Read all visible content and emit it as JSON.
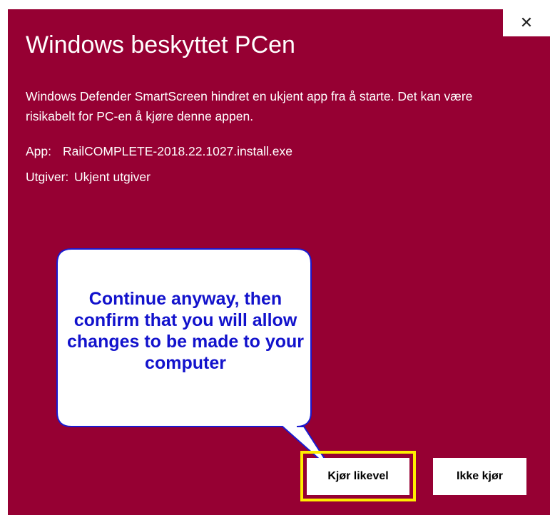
{
  "dialog": {
    "close_glyph": "✕",
    "title": "Windows beskyttet PCen",
    "description": "Windows Defender SmartScreen hindret en ukjent app fra å starte. Det kan være risikabelt for PC-en å kjøre denne appen.",
    "app_label": "App:",
    "app_value": "RailCOMPLETE-2018.22.1027.install.exe",
    "publisher_label": "Utgiver:",
    "publisher_value": "Ukjent utgiver",
    "run_anyway_label": "Kjør likevel",
    "dont_run_label": "Ikke kjør",
    "background_color": "#960033"
  },
  "callout": {
    "text": "Continue anyway, then confirm that you will allow changes to be made to your computer",
    "text_color": "#1212cc",
    "border_color": "#1a1ad0",
    "highlight_color": "#ffee00"
  }
}
